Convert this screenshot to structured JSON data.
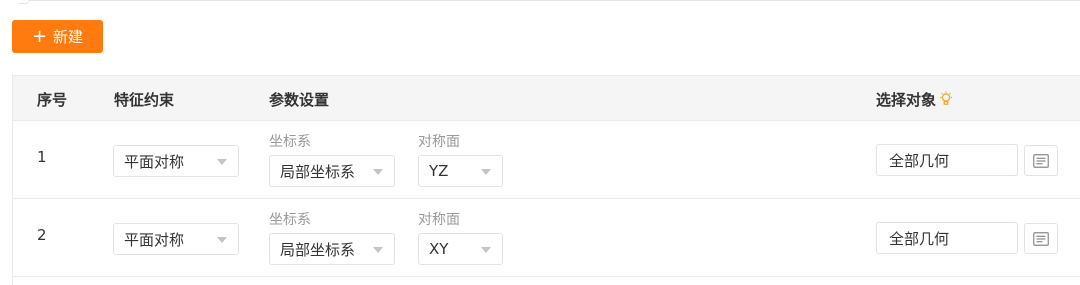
{
  "toolbar": {
    "new_label": "新建",
    "new_icon": "plus-icon",
    "accent": "#ff7a0f"
  },
  "table": {
    "headers": {
      "index": "序号",
      "constraint": "特征约束",
      "params": "参数设置",
      "target": "选择对象",
      "target_icon": "lightbulb-icon"
    },
    "param_labels": {
      "coord": "坐标系",
      "plane": "对称面"
    },
    "rows": [
      {
        "index": "1",
        "constraint": "平面对称",
        "coord": "局部坐标系",
        "plane": "YZ",
        "target": "全部几何"
      },
      {
        "index": "2",
        "constraint": "平面对称",
        "coord": "局部坐标系",
        "plane": "XY",
        "target": "全部几何"
      }
    ]
  }
}
